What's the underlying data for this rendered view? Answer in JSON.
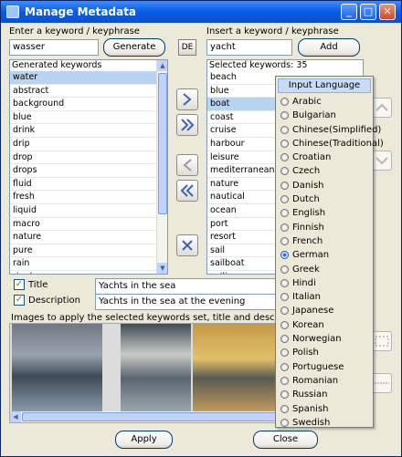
{
  "window": {
    "title": "Manage Metadata"
  },
  "left": {
    "enter_label": "Enter a keyword / keyphrase",
    "keyword_value": "wasser",
    "generate_label": "Generate",
    "lang_btn": "DE",
    "generated_header": "Generated keywords",
    "generated": [
      "water",
      "abstract",
      "background",
      "blue",
      "drink",
      "drip",
      "drop",
      "drops",
      "fluid",
      "fresh",
      "liquid",
      "macro",
      "nature",
      "pure",
      "rain",
      "ripple"
    ]
  },
  "right": {
    "insert_label": "Insert a keyword / keyphrase",
    "keyword_value": "yacht",
    "add_label": "Add",
    "selected_header": "Selected keywords: 35",
    "selected": [
      "beach",
      "blue",
      "boat",
      "coast",
      "cruise",
      "harbour",
      "leisure",
      "mediterranean",
      "nature",
      "nautical",
      "ocean",
      "port",
      "resort",
      "sail",
      "sailboat",
      "sailing"
    ]
  },
  "meta": {
    "title_label": "Title",
    "title_value": "Yachts in the sea",
    "desc_label": "Description",
    "desc_value": "Yachts in the sea at the evening"
  },
  "images_label": "Images to apply the selected keywords set, title and description",
  "popup": {
    "header": "Input Language",
    "languages": [
      "Arabic",
      "Bulgarian",
      "Chinese(Simplified)",
      "Chinese(Traditional)",
      "Croatian",
      "Czech",
      "Danish",
      "Dutch",
      "English",
      "Finnish",
      "French",
      "German",
      "Greek",
      "Hindi",
      "Italian",
      "Japanese",
      "Korean",
      "Norwegian",
      "Polish",
      "Portuguese",
      "Romanian",
      "Russian",
      "Spanish",
      "Swedish"
    ],
    "selected": "German"
  },
  "footer": {
    "apply": "Apply",
    "close": "Close"
  },
  "colors": {
    "titlebar": "#0a5ce6",
    "selection": "#b9d4f1",
    "window_bg": "#ece9d8"
  }
}
